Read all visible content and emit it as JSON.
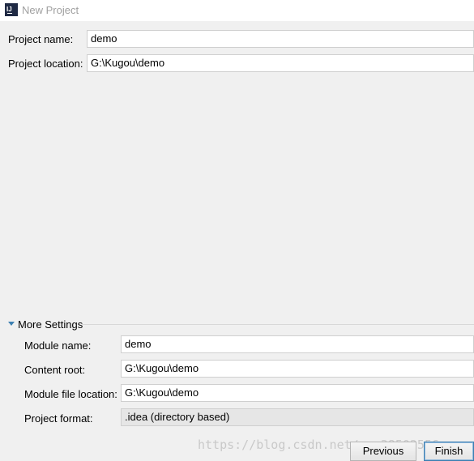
{
  "window": {
    "title": "New Project",
    "icon": "intellij-logo-icon"
  },
  "project": {
    "name_label": "Project name:",
    "name_value": "demo",
    "location_label": "Project location:",
    "location_value": "G:\\Kugou\\demo"
  },
  "more_settings": {
    "label": "More Settings",
    "expanded": true,
    "module_name_label": "Module name:",
    "module_name_value": "demo",
    "content_root_label": "Content root:",
    "content_root_value": "G:\\Kugou\\demo",
    "module_file_label": "Module file location:",
    "module_file_value": "G:\\Kugou\\demo",
    "format_label": "Project format:",
    "format_value": ".idea (directory based)"
  },
  "buttons": {
    "previous": "Previous",
    "finish": "Finish"
  },
  "watermark": "https://blog.csdn.net/qq_38502556",
  "colors": {
    "background": "#f0f0f0",
    "accent": "#3c7fb1"
  }
}
